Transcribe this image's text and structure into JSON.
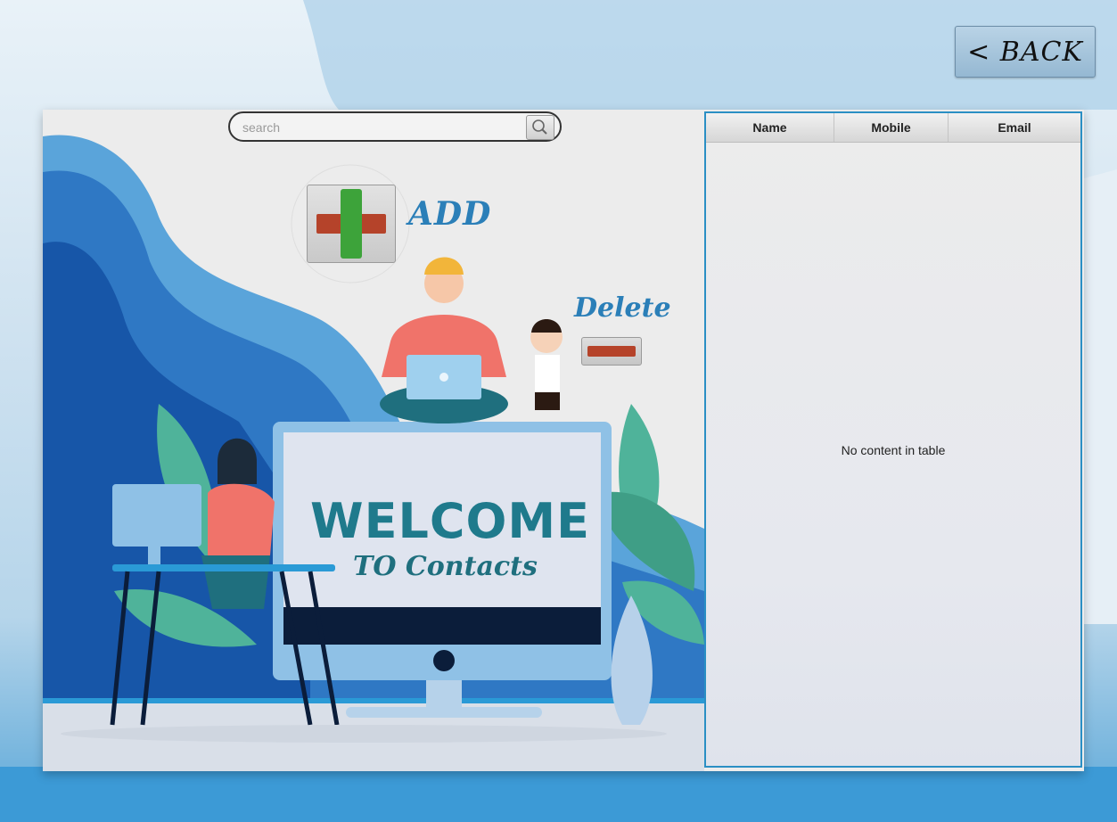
{
  "window": {
    "back_label": "< BACK"
  },
  "search": {
    "placeholder": "search",
    "value": "",
    "icon": "magnifier-icon"
  },
  "actions": {
    "add_label": "ADD",
    "add_icon": "plus-icon",
    "delete_label": "Delete",
    "delete_icon": "minus-icon"
  },
  "illustration": {
    "welcome_text": "WELCOME",
    "subtitle_text": "TO Contacts"
  },
  "table": {
    "columns": [
      "Name",
      "Mobile",
      "Email"
    ],
    "rows": [],
    "empty_message": "No content in table"
  },
  "colors": {
    "accent": "#2b7fb8",
    "table_border": "#2a8fc4",
    "welcome": "#1f7a8c",
    "add_green": "#3da33a",
    "remove_red": "#b5432a"
  }
}
